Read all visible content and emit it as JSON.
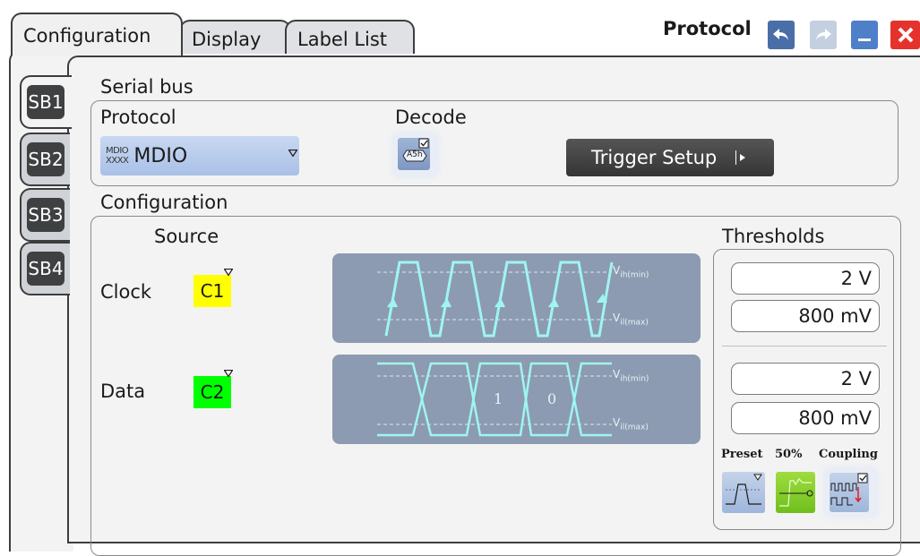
{
  "tabs": [
    "Configuration",
    "Display",
    "Label List"
  ],
  "window_title": "Protocol",
  "sb_tabs": [
    "SB1",
    "SB2",
    "SB3",
    "SB4"
  ],
  "serial_bus": {
    "section_title": "Serial bus",
    "protocol_label": "Protocol",
    "protocol_icon_text": [
      "MDIO",
      "XXXX"
    ],
    "protocol_value": "MDIO",
    "decode_label": "Decode",
    "decode_icon_text": "A5h",
    "trigger_setup": "Trigger Setup"
  },
  "configuration": {
    "section_title": "Configuration",
    "source_label": "Source",
    "clock_label": "Clock",
    "clock_source": "C1",
    "data_label": "Data",
    "data_source": "C2",
    "wave_labels": {
      "vih": "V",
      "vih_sub": "ih(min)",
      "vil": "V",
      "vil_sub": "il(max)",
      "bit1": "1",
      "bit0": "0"
    },
    "colors": {
      "c1": "#ffff00",
      "c2": "#00ff00",
      "wave_bg": "#8c9bb1",
      "wave_line": "#9ff5f0"
    }
  },
  "thresholds": {
    "title": "Thresholds",
    "clock_high": "2 V",
    "clock_low": "800 mV",
    "data_high": "2 V",
    "data_low": "800 mV",
    "preset_label": "Preset",
    "fifty_label": "50%",
    "coupling_label": "Coupling"
  }
}
